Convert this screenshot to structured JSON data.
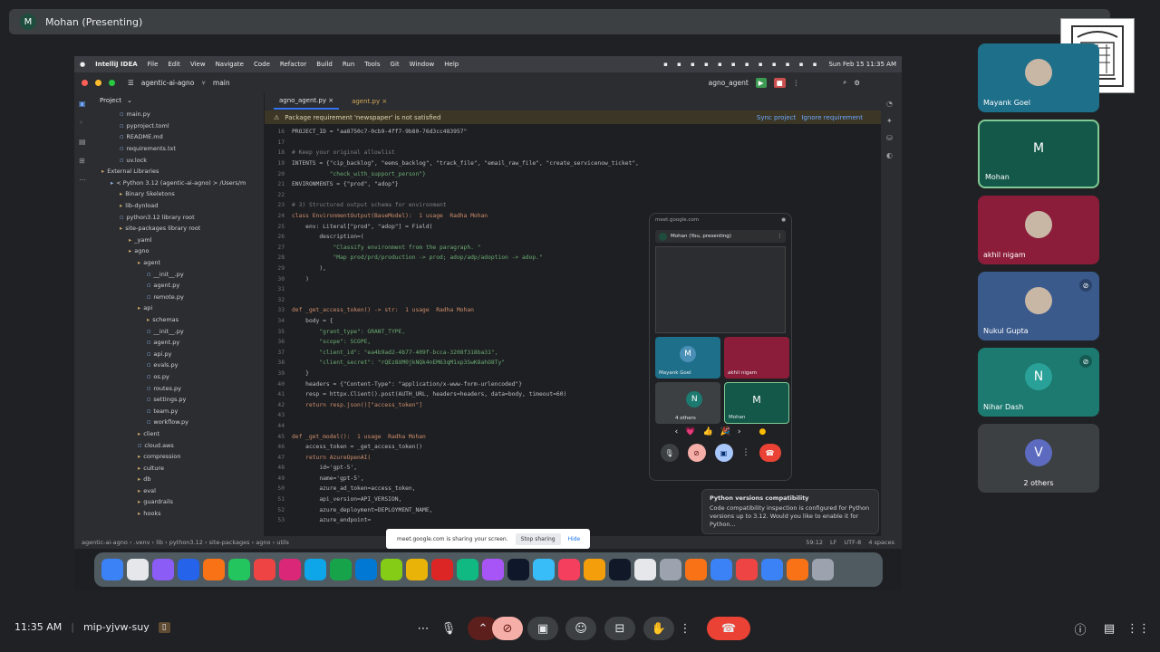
{
  "top_bar": {
    "avatar_letter": "M",
    "title": "Mohan (Presenting)"
  },
  "ide": {
    "mac_menu": [
      "IntelliJ IDEA",
      "File",
      "Edit",
      "View",
      "Navigate",
      "Code",
      "Refactor",
      "Build",
      "Run",
      "Tools",
      "Git",
      "Window",
      "Help"
    ],
    "clock": "Sun Feb 15 11:35 AM",
    "project_name": "agentic-ai-agno",
    "branch": "main",
    "run_config": "agno_agent",
    "panel_title": "Project",
    "tree": [
      {
        "indent": 2,
        "label": "main.py"
      },
      {
        "indent": 2,
        "label": "pyproject.toml"
      },
      {
        "indent": 2,
        "label": "README.md"
      },
      {
        "indent": 2,
        "label": "requirements.txt"
      },
      {
        "indent": 2,
        "label": "uv.lock"
      },
      {
        "indent": 0,
        "label": "External Libraries"
      },
      {
        "indent": 1,
        "label": "< Python 3.12 (agentic-ai-agno) >  /Users/m"
      },
      {
        "indent": 2,
        "label": "Binary Skeletons"
      },
      {
        "indent": 2,
        "label": "lib-dynload"
      },
      {
        "indent": 2,
        "label": "python3.12  library root"
      },
      {
        "indent": 2,
        "label": "site-packages  library root"
      },
      {
        "indent": 3,
        "label": "_yaml"
      },
      {
        "indent": 3,
        "label": "agno"
      },
      {
        "indent": 4,
        "label": "agent"
      },
      {
        "indent": 5,
        "label": "__init__.py"
      },
      {
        "indent": 5,
        "label": "agent.py"
      },
      {
        "indent": 5,
        "label": "remote.py"
      },
      {
        "indent": 4,
        "label": "api"
      },
      {
        "indent": 5,
        "label": "schemas"
      },
      {
        "indent": 5,
        "label": "__init__.py"
      },
      {
        "indent": 5,
        "label": "agent.py"
      },
      {
        "indent": 5,
        "label": "api.py"
      },
      {
        "indent": 5,
        "label": "evals.py"
      },
      {
        "indent": 5,
        "label": "os.py"
      },
      {
        "indent": 5,
        "label": "routes.py"
      },
      {
        "indent": 5,
        "label": "settings.py"
      },
      {
        "indent": 5,
        "label": "team.py"
      },
      {
        "indent": 5,
        "label": "workflow.py"
      },
      {
        "indent": 4,
        "label": "client"
      },
      {
        "indent": 4,
        "label": "cloud.aws"
      },
      {
        "indent": 4,
        "label": "compression"
      },
      {
        "indent": 4,
        "label": "culture"
      },
      {
        "indent": 4,
        "label": "db"
      },
      {
        "indent": 4,
        "label": "eval"
      },
      {
        "indent": 4,
        "label": "guardrails"
      },
      {
        "indent": 4,
        "label": "hooks"
      }
    ],
    "tabs": [
      "agno_agent.py",
      "agent.py"
    ],
    "warning": "Package requirement 'newspaper' is not satisfied",
    "warning_actions": [
      "Sync project",
      "Ignore requirement"
    ],
    "code": [
      {
        "n": "16",
        "t": "PROJECT_ID = \"aa8750c7-0cb9-4ff7-9b80-76d3cc483957\""
      },
      {
        "n": "17",
        "t": ""
      },
      {
        "n": "18",
        "t": "# Keep your original allowlist"
      },
      {
        "n": "19",
        "t": "INTENTS = {\"cip_backlog\", \"eems_backlog\", \"track_file\", \"email_raw_file\", \"create_servicenow_ticket\","
      },
      {
        "n": "20",
        "t": "           \"check_with_support_person\"}"
      },
      {
        "n": "21",
        "t": "ENVIRONMENTS = {\"prod\", \"adop\"}"
      },
      {
        "n": "22",
        "t": ""
      },
      {
        "n": "23",
        "t": "# 3) Structured output schema for environment"
      },
      {
        "n": "24",
        "t": "class EnvironmentOutput(BaseModel):  1 usage  Radha Mohan"
      },
      {
        "n": "25",
        "t": "    env: Literal[\"prod\", \"adop\"] = Field("
      },
      {
        "n": "26",
        "t": "        description=("
      },
      {
        "n": "27",
        "t": "            \"Classify environment from the paragraph. \""
      },
      {
        "n": "28",
        "t": "            \"Map prod/prd/production -> prod; adop/adp/adoption -> adop.\""
      },
      {
        "n": "29",
        "t": "        ),"
      },
      {
        "n": "30",
        "t": "    )"
      },
      {
        "n": "31",
        "t": ""
      },
      {
        "n": "32",
        "t": ""
      },
      {
        "n": "33",
        "t": "def _get_access_token() -> str:  1 usage  Radha Mohan"
      },
      {
        "n": "34",
        "t": "    body = {"
      },
      {
        "n": "35",
        "t": "        \"grant_type\": GRANT_TYPE,"
      },
      {
        "n": "36",
        "t": "        \"scope\": SCOPE,"
      },
      {
        "n": "37",
        "t": "        \"client_id\": \"ea4b9ad2-4b77-409f-bcca-3208f318ba31\","
      },
      {
        "n": "38",
        "t": "        \"client_secret\": \"rQEz8XM0jkNQk4nEM63qM1xp3SwK8ahO8Ty\""
      },
      {
        "n": "39",
        "t": "    }"
      },
      {
        "n": "40",
        "t": "    headers = {\"Content-Type\": \"application/x-www-form-urlencoded\"}"
      },
      {
        "n": "41",
        "t": "    resp = httpx.Client().post(AUTH_URL, headers=headers, data=body, timeout=60)"
      },
      {
        "n": "42",
        "t": "    return resp.json()[\"access_token\"]"
      },
      {
        "n": "43",
        "t": ""
      },
      {
        "n": "44",
        "t": ""
      },
      {
        "n": "45",
        "t": "def _get_model():  1 usage  Radha Mohan"
      },
      {
        "n": "46",
        "t": "    access_token = _get_access_token()"
      },
      {
        "n": "47",
        "t": "    return AzureOpenAI("
      },
      {
        "n": "48",
        "t": "        id='gpt-5',"
      },
      {
        "n": "49",
        "t": "        name='gpt-5',"
      },
      {
        "n": "50",
        "t": "        azure_ad_token=access_token,"
      },
      {
        "n": "51",
        "t": "        api_version=API_VERSION,"
      },
      {
        "n": "52",
        "t": "        azure_deployment=DEPLOYMENT_NAME,"
      },
      {
        "n": "53",
        "t": "        azure_endpoint="
      }
    ],
    "status_path": [
      "agentic-ai-agno",
      ".venv",
      "lib",
      "python3.12",
      "site-packages",
      "agno",
      "utils"
    ],
    "status_right": [
      "59:12",
      "LF",
      "UTF-8",
      "4 spaces"
    ],
    "compat_title": "Python versions compatibility",
    "compat_body": "Code compatibility inspection is configured for Python versions up to 3.12. Would you like to enable it for Python..."
  },
  "pip": {
    "url": "meet.google.com",
    "presenter": "Mohan (You, presenting)",
    "tiles": [
      {
        "name": "Mayank Goel",
        "letter": "M"
      },
      {
        "name": "akhil nigam",
        "letter": ""
      },
      {
        "name": "4 others",
        "letter": "N"
      },
      {
        "name": "Mohan",
        "letter": "M"
      }
    ],
    "reactions": [
      "💗",
      "👍",
      "🎉"
    ]
  },
  "sharing_banner": {
    "text": "meet.google.com is sharing your screen.",
    "stop": "Stop sharing",
    "hide": "Hide"
  },
  "participants": [
    {
      "name": "Mayank Goel",
      "letter": "",
      "color": "#1e6f8a"
    },
    {
      "name": "Mohan",
      "letter": "M",
      "color": "#14584a"
    },
    {
      "name": "akhil nigam",
      "letter": "",
      "color": "#8c1d3a"
    },
    {
      "name": "Nukul Gupta",
      "letter": "",
      "color": "#3a5a8c"
    },
    {
      "name": "Nihar Dash",
      "letter": "N",
      "color": "#1c7a70"
    },
    {
      "name": "2 others",
      "letter": "V",
      "color": "#3c4043"
    }
  ],
  "bottom": {
    "time": "11:35 AM",
    "meeting_code": "mip-yjvw-suy"
  },
  "colors": {
    "end_call": "#ea4335",
    "active_tile_border": "#81c995"
  }
}
